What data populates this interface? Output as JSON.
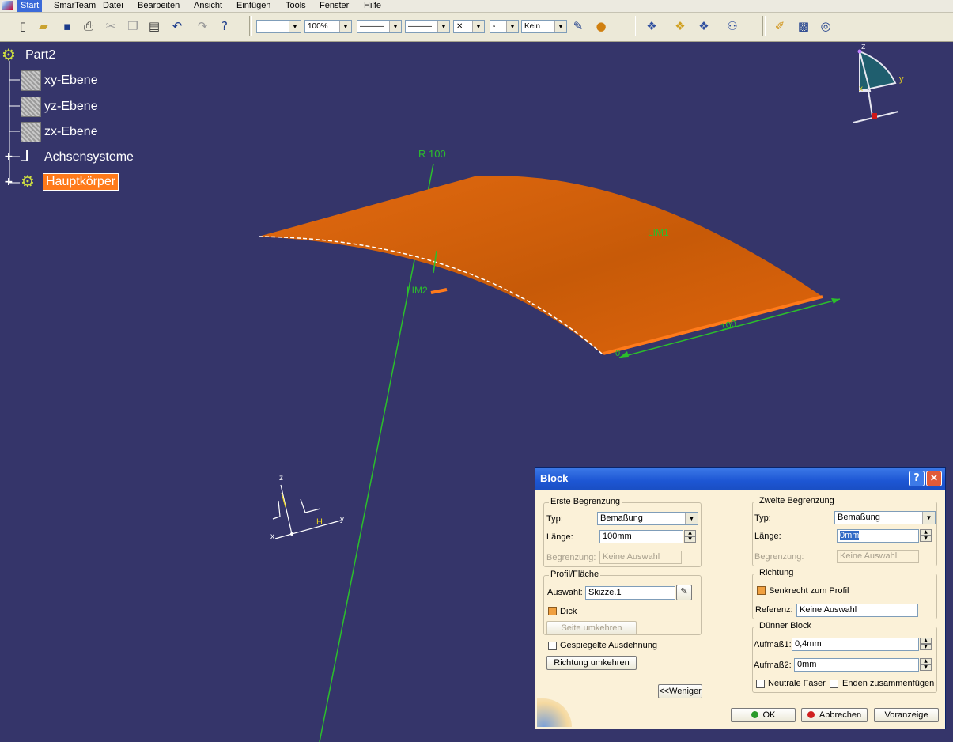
{
  "menubar": {
    "items": [
      "Start",
      "SmarTeam",
      "Datei",
      "Bearbeiten",
      "Ansicht",
      "Einfügen",
      "Tools",
      "Fenster",
      "Hilfe"
    ]
  },
  "toolbar": {
    "zoom_value": "100%",
    "layer_value": "Kein"
  },
  "tree": {
    "root": "Part2",
    "items": [
      "xy-Ebene",
      "yz-Ebene",
      "zx-Ebene",
      "Achsensysteme",
      "Hauptkörper"
    ]
  },
  "viewport": {
    "annotations": {
      "radius": "R 100",
      "lim1": "LIM1",
      "lim2": "LIM2",
      "length": "100",
      "zero": "0",
      "h_label": "H"
    },
    "compass_axes": {
      "z": "z",
      "y": "y",
      "x": "x"
    },
    "axis_triad": {
      "z": "z",
      "y": "y",
      "x": "x"
    }
  },
  "dialog": {
    "title": "Block",
    "first_limit": {
      "title": "Erste Begrenzung",
      "type_label": "Typ:",
      "type_value": "Bemaßung",
      "length_label": "Länge:",
      "length_value": "100mm",
      "limit_label": "Begrenzung:",
      "limit_value": "Keine Auswahl"
    },
    "profile": {
      "title": "Profil/Fläche",
      "selection_label": "Auswahl:",
      "selection_value": "Skizze.1",
      "thick_label": "Dick",
      "reverse_side_label": "Seite umkehren"
    },
    "mirrored_label": "Gespiegelte Ausdehnung",
    "reverse_direction_label": "Richtung umkehren",
    "second_limit": {
      "title": "Zweite Begrenzung",
      "type_label": "Typ:",
      "type_value": "Bemaßung",
      "length_label": "Länge:",
      "length_value": "0mm",
      "limit_label": "Begrenzung:",
      "limit_value": "Keine Auswahl"
    },
    "direction": {
      "title": "Richtung",
      "normal_label": "Senkrecht zum Profil",
      "reference_label": "Referenz:",
      "reference_value": "Keine Auswahl"
    },
    "thin_block": {
      "title": "Dünner Block",
      "thickness1_label": "Aufmaß1:",
      "thickness1_value": "0,4mm",
      "thickness2_label": "Aufmaß2:",
      "thickness2_value": "0mm",
      "neutral_label": "Neutrale Faser",
      "merge_label": "Enden zusammenfügen"
    },
    "less_button": "<<Weniger",
    "ok_button": "OK",
    "cancel_button": "Abbrechen",
    "preview_button": "Voranzeige",
    "help_button": "?",
    "close_button": "×"
  }
}
